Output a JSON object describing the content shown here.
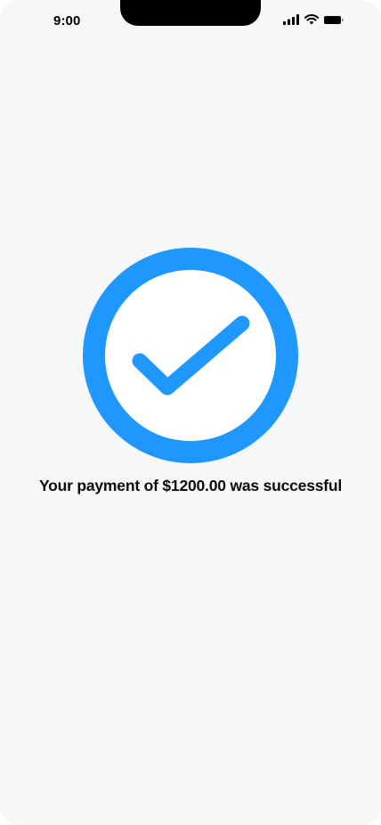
{
  "status_bar": {
    "time": "9:00",
    "icons": [
      "signal-icon",
      "wifi-icon",
      "battery-icon"
    ]
  },
  "success": {
    "icon": "check-circle-icon",
    "accent_color": "#1e98ff",
    "message": "Your payment of $1200.00 was successful"
  },
  "colors": {
    "background": "#f5f7f9",
    "text": "#0b0b0b"
  }
}
